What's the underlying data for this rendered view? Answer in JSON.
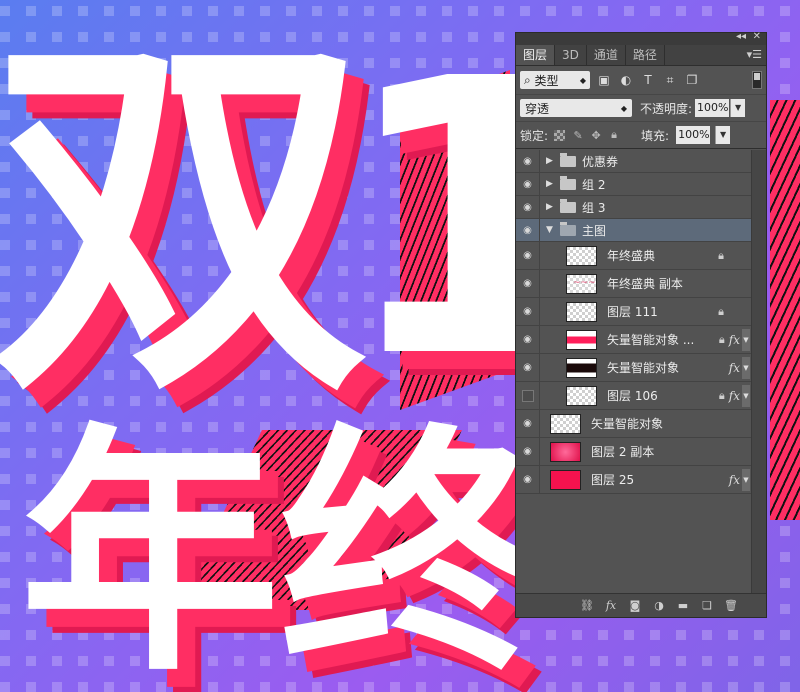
{
  "panel": {
    "tabs": [
      {
        "label": "图层",
        "active": true
      },
      {
        "label": "3D",
        "active": false
      },
      {
        "label": "通道",
        "active": false
      },
      {
        "label": "路径",
        "active": false
      }
    ],
    "filter": {
      "label": "类型",
      "icons": [
        "image-filter-icon",
        "adjustment-filter-icon",
        "type-filter-icon",
        "shape-filter-icon",
        "smart-object-filter-icon"
      ]
    },
    "blend_mode": "穿透",
    "opacity_label": "不透明度:",
    "opacity_value": "100%",
    "lock_label": "锁定:",
    "fill_label": "填充:",
    "fill_value": "100%",
    "layers": [
      {
        "name": "优惠券",
        "kind": "group",
        "expanded": false,
        "visible": true
      },
      {
        "name": "组 2",
        "kind": "group",
        "expanded": false,
        "visible": true
      },
      {
        "name": "组 3",
        "kind": "group",
        "expanded": false,
        "visible": true
      },
      {
        "name": "主图",
        "kind": "group",
        "expanded": true,
        "visible": true,
        "selected": true
      },
      {
        "name": "年终盛典",
        "kind": "layer",
        "indent": true,
        "visible": true,
        "locked": true,
        "fx": false
      },
      {
        "name": "年终盛典 副本",
        "kind": "layer",
        "indent": true,
        "visible": true,
        "locked": false,
        "fx": false
      },
      {
        "name": "图层 111",
        "kind": "layer",
        "indent": true,
        "visible": true,
        "locked": true,
        "fx": false
      },
      {
        "name": "矢量智能对象 ...",
        "kind": "layer",
        "indent": true,
        "visible": true,
        "locked": true,
        "fx": true
      },
      {
        "name": "矢量智能对象",
        "kind": "layer",
        "indent": true,
        "visible": true,
        "locked": false,
        "fx": true
      },
      {
        "name": "图层 106",
        "kind": "layer",
        "indent": true,
        "visible": false,
        "locked": true,
        "fx": true
      },
      {
        "name": "矢量智能对象",
        "kind": "layer",
        "indent": false,
        "visible": true,
        "locked": false,
        "fx": false
      },
      {
        "name": "图层 2 副本",
        "kind": "layer",
        "indent": false,
        "visible": true,
        "locked": false,
        "fx": false
      },
      {
        "name": "图层 25",
        "kind": "layer",
        "indent": false,
        "visible": true,
        "locked": false,
        "fx": true
      }
    ],
    "bottom_icons": [
      "link-icon",
      "fx-icon",
      "mask-icon",
      "adjustment-icon",
      "new-group-icon",
      "new-layer-icon",
      "delete-icon"
    ]
  },
  "canvas": {
    "big_text_top": "双1",
    "big_text_bottom": "年终"
  },
  "colors": {
    "accent_pink": "#ff2e63",
    "panel_bg": "#535353",
    "selected_row": "#5d6a7a"
  }
}
